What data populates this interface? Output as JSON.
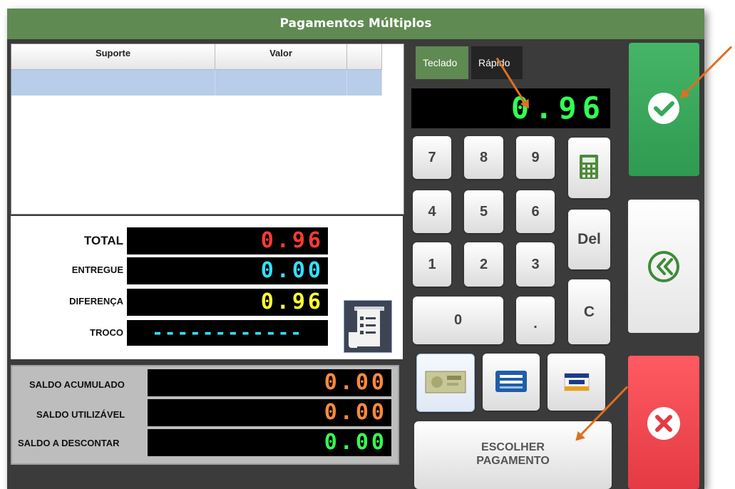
{
  "window": {
    "title": "Pagamentos Múltiplos"
  },
  "table": {
    "columns": [
      "Suporte",
      "Valor",
      ""
    ]
  },
  "totals": {
    "total_label": "TOTAL",
    "total_value": "0.96",
    "entregue_label": "ENTREGUE",
    "entregue_value": "0.00",
    "diferenca_label": "DIFERENÇA",
    "diferenca_value": "0.96",
    "troco_label": "TROCO",
    "troco_value": "------------"
  },
  "saldo": {
    "acumulado_label": "SALDO ACUMULADO",
    "acumulado_value": "0.00",
    "utilizavel_label": "SALDO UTILIZÁVEL",
    "utilizavel_value": "0.00",
    "descontar_label": "SALDO A DESCONTAR",
    "descontar_value": "0.00"
  },
  "keypad": {
    "tabs": [
      "Teclado",
      "Rápido"
    ],
    "display": "0.96",
    "keys": [
      "7",
      "8",
      "9",
      "4",
      "5",
      "6",
      "1",
      "2",
      "3",
      "0",
      "."
    ],
    "del_label": "Del",
    "clear_label": "C"
  },
  "payment": {
    "methods": [
      "banknote-icon",
      "multibanco-icon",
      "visa-icon"
    ],
    "choose_label_1": "ESCOLHER",
    "choose_label_2": "PAGAMENTO"
  },
  "colors": {
    "title_green": "#5f8a52",
    "confirm_green": "#3aa65c",
    "cancel_red": "#e8414a",
    "lcd_red": "#ff3b30",
    "lcd_cyan": "#33e0ff",
    "lcd_yellow": "#ffff33",
    "lcd_orange": "#ff8a3c",
    "lcd_green": "#33ff55",
    "arrow_orange": "#e0701f"
  }
}
